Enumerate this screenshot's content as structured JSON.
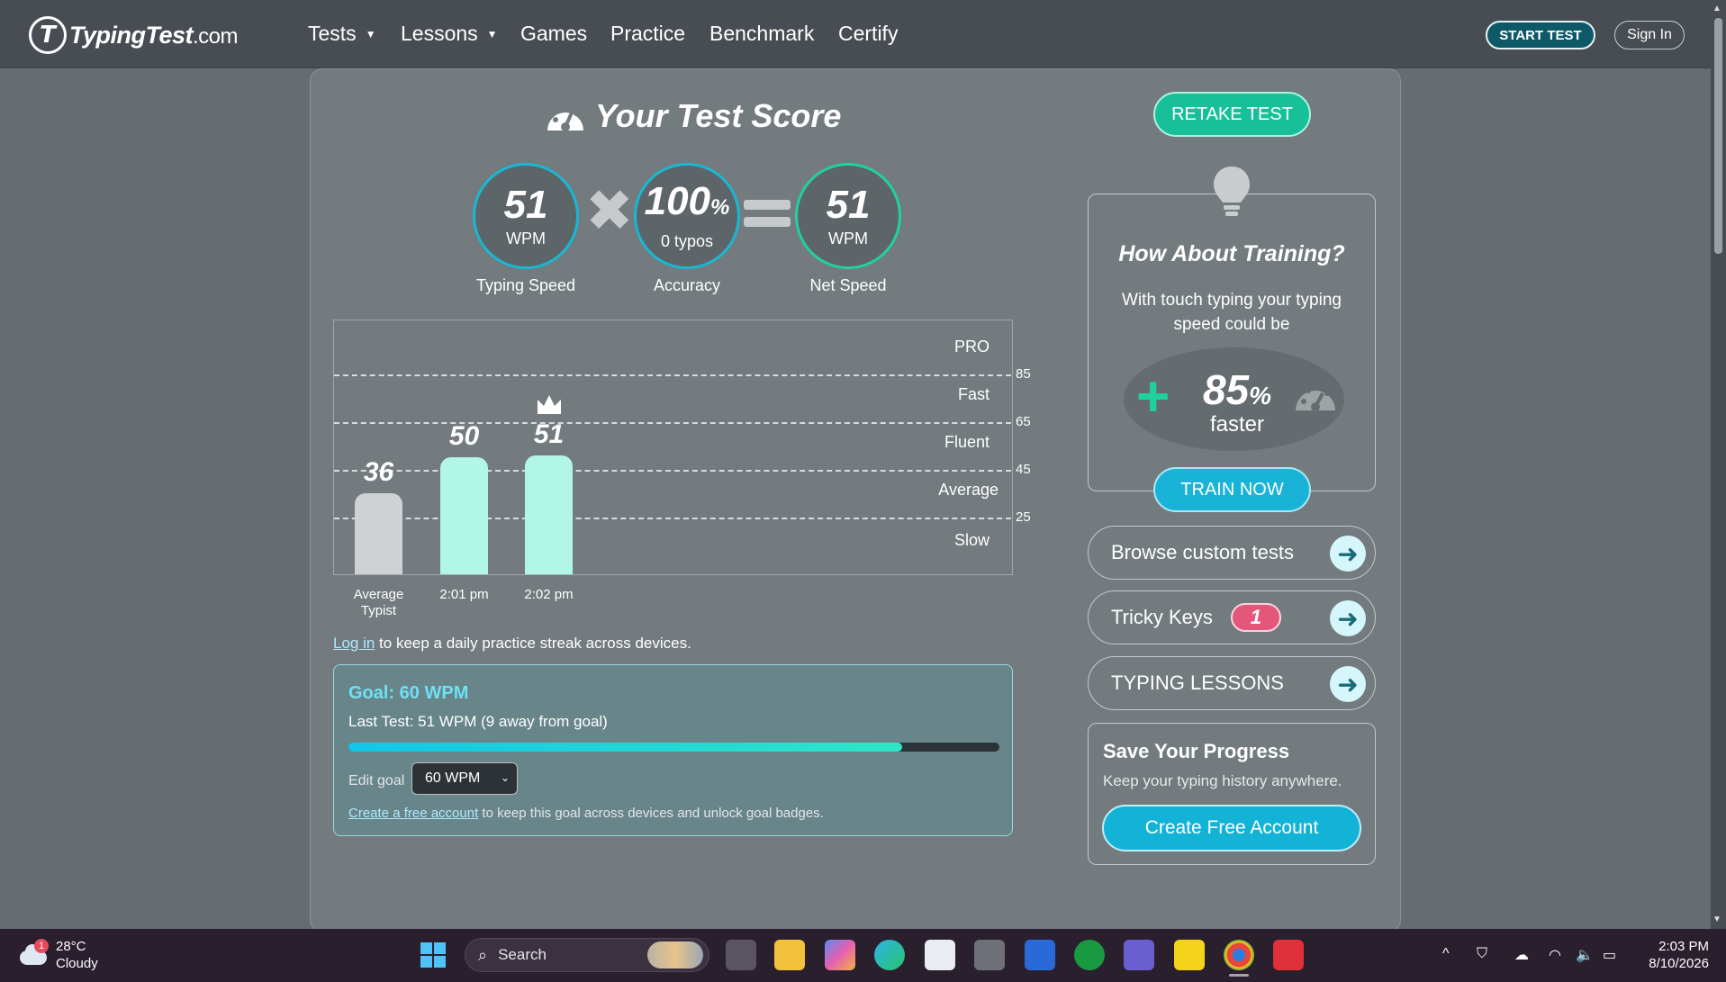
{
  "header": {
    "logo_mark": "T",
    "logo_text": "TypingTest",
    "logo_domain": ".com",
    "nav": [
      {
        "label": "Tests",
        "dropdown": true
      },
      {
        "label": "Lessons",
        "dropdown": true
      },
      {
        "label": "Games",
        "dropdown": false
      },
      {
        "label": "Practice",
        "dropdown": false
      },
      {
        "label": "Benchmark",
        "dropdown": false
      },
      {
        "label": "Certify",
        "dropdown": false
      }
    ],
    "start_test": "START TEST",
    "sign_in": "Sign In"
  },
  "score": {
    "title": "Your Test Score",
    "speed": {
      "value": "51",
      "unit": "WPM",
      "label": "Typing Speed"
    },
    "accuracy": {
      "value": "100",
      "suffix": "%",
      "sub": "0 typos",
      "label": "Accuracy"
    },
    "net": {
      "value": "51",
      "unit": "WPM",
      "label": "Net Speed"
    }
  },
  "chart_data": {
    "type": "bar",
    "categories": [
      "Average Typist",
      "2:01 pm",
      "2:02 pm"
    ],
    "values": [
      36,
      50,
      51
    ],
    "value_labels": [
      "36",
      "50",
      "51"
    ],
    "bar_colors": [
      "#cfd2d4",
      "#b2f7e6",
      "#b2f7e6"
    ],
    "best_index": 2,
    "ylim": [
      0,
      100
    ],
    "thresholds": [
      {
        "value": 85,
        "label": "85"
      },
      {
        "value": 65,
        "label": "65"
      },
      {
        "value": 45,
        "label": "45"
      },
      {
        "value": 25,
        "label": "25"
      }
    ],
    "tiers": [
      "PRO",
      "Fast",
      "Fluent",
      "Average",
      "Slow"
    ]
  },
  "login_note": {
    "link": "Log in",
    "text": " to keep a daily practice streak across devices."
  },
  "goal": {
    "title": "Goal: 60 WPM",
    "last_test": "Last Test: 51 WPM (9 away from goal)",
    "progress": 0.85,
    "edit_label": "Edit goal",
    "selected": "60 WPM",
    "footer_link": "Create a free account",
    "footer_text": " to keep this goal across devices and unlock goal badges."
  },
  "training": {
    "retake": "RETAKE TEST",
    "title": "How About Training?",
    "sub": "With touch typing your typing speed could be",
    "plus": "+",
    "percent": "85",
    "percent_sign": "%",
    "faster": "faster",
    "train_now": "TRAIN NOW"
  },
  "links": {
    "browse": "Browse custom tests",
    "tricky": "Tricky Keys",
    "tricky_count": "1",
    "lessons": "TYPING LESSONS",
    "arrow": "➜"
  },
  "save": {
    "title": "Save Your Progress",
    "sub": "Keep your typing history anywhere.",
    "button": "Create Free Account"
  },
  "taskbar": {
    "weather_temp": "28°C",
    "weather_desc": "Cloudy",
    "weather_badge": "1",
    "search": "Search",
    "time": "2:03 PM",
    "date": "8/10/2026"
  }
}
